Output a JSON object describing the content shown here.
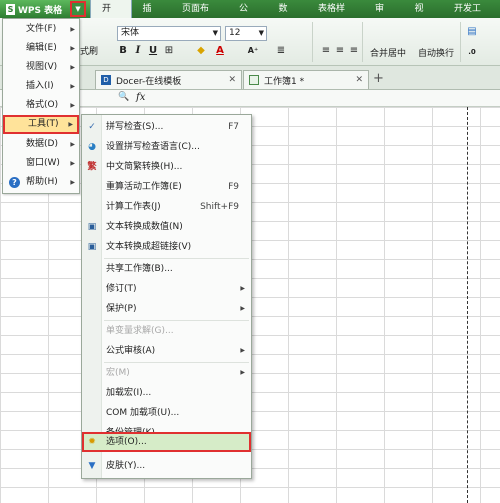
{
  "app": {
    "title": "WPS 表格",
    "logo": "S"
  },
  "tabs": [
    "开始",
    "插入",
    "页面布局",
    "公式",
    "数据",
    "表格样式",
    "审阅",
    "视图",
    "开发工具"
  ],
  "ribbon": {
    "brush_label": "式刷",
    "font_name": "宋体",
    "font_size": "12",
    "merge_label": "合并居中",
    "wrap_label": "自动换行"
  },
  "doc_tabs": [
    {
      "label": "Docer-在线模板",
      "icon": "docer-icon"
    },
    {
      "label": "工作簿1 *",
      "icon": "sheet-icon"
    }
  ],
  "app_menu": [
    {
      "label": "文件(F)"
    },
    {
      "label": "编辑(E)"
    },
    {
      "label": "视图(V)"
    },
    {
      "label": "插入(I)"
    },
    {
      "label": "格式(O)"
    },
    {
      "label": "工具(T)",
      "selected": true
    },
    {
      "label": "数据(D)"
    },
    {
      "label": "窗口(W)"
    },
    {
      "label": "帮助(H)",
      "icon": "help-icon"
    }
  ],
  "tools_menu": [
    {
      "label": "拼写检查(S)...",
      "shortcut": "F7",
      "icon": "spell-check-icon"
    },
    {
      "label": "设置拼写检查语言(C)...",
      "icon": "language-icon"
    },
    {
      "label": "中文简繁转换(H)...",
      "icon": "convert-icon"
    },
    {
      "label": "重算活动工作簿(E)",
      "shortcut": "F9"
    },
    {
      "label": "计算工作表(J)",
      "shortcut": "Shift+F9"
    },
    {
      "label": "文本转换成数值(N)",
      "icon": "text-to-number-icon"
    },
    {
      "label": "文本转换成超链接(V)",
      "icon": "text-to-link-icon"
    },
    {
      "label": "共享工作簿(B)..."
    },
    {
      "label": "修订(T)",
      "submenu": true
    },
    {
      "label": "保护(P)",
      "submenu": true
    },
    {
      "label": "单变量求解(G)...",
      "disabled": true
    },
    {
      "label": "公式审核(A)",
      "submenu": true
    },
    {
      "label": "宏(M)",
      "disabled": true,
      "submenu": true
    },
    {
      "label": "加载宏(I)..."
    },
    {
      "label": "COM 加载项(U)..."
    },
    {
      "label": "备份管理(K)..."
    },
    {
      "label": "选项(O)...",
      "icon": "gear-icon",
      "highlighted": true
    },
    {
      "label": "皮肤(Y)...",
      "icon": "skin-icon"
    }
  ],
  "colors": {
    "accent_green": "#2e7d32",
    "highlight_red": "#e03030"
  }
}
